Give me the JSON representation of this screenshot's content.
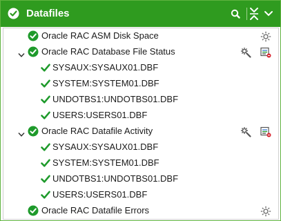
{
  "header": {
    "title": "Datafiles",
    "status_icon": "check-circle-icon",
    "actions": [
      "search-icon",
      "collapse-all-icon",
      "chevron-down-icon"
    ],
    "accent_color": "#2f9b1f"
  },
  "tree": {
    "groups": [
      {
        "label": "Oracle RAC ASM Disk Space",
        "expandable": false,
        "actions": [
          "gear-icon"
        ]
      },
      {
        "label": "Oracle RAC Database File Status",
        "expandable": true,
        "expanded": true,
        "actions": [
          "wrench-icon",
          "report-icon"
        ],
        "children": [
          "SYSAUX:SYSAUX01.DBF",
          "SYSTEM:SYSTEM01.DBF",
          "UNDOTBS1:UNDOTBS01.DBF",
          "USERS:USERS01.DBF"
        ]
      },
      {
        "label": "Oracle RAC Datafile Activity",
        "expandable": true,
        "expanded": true,
        "actions": [
          "wrench-icon",
          "report-icon"
        ],
        "children": [
          "SYSAUX:SYSAUX01.DBF",
          "SYSTEM:SYSTEM01.DBF",
          "UNDOTBS1:UNDOTBS01.DBF",
          "USERS:USERS01.DBF"
        ]
      },
      {
        "label": "Oracle RAC Datafile Errors",
        "expandable": false,
        "actions": [
          "gear-icon"
        ]
      }
    ]
  },
  "colors": {
    "ok_green": "#1e9a2b",
    "border": "#cfcfcf"
  }
}
